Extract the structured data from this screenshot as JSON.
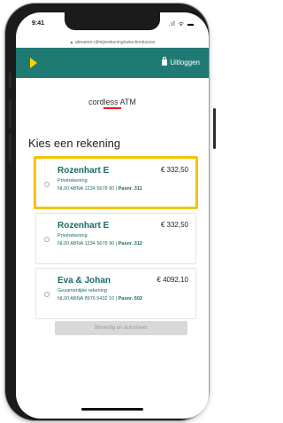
{
  "status": {
    "time": "9:41",
    "icons": ".ıl ᯤ ▬"
  },
  "browser": {
    "url": "▲ abnamro.nl/mijnrekening/selectiontuvzoo"
  },
  "header": {
    "logout_label": "Uitloggen",
    "accent": "#1f7a73",
    "logo_color": "#ffd200"
  },
  "brand": {
    "name": "cordless ATM"
  },
  "main": {
    "title": "Kies een rekening",
    "accounts": [
      {
        "name": "Rozenhart E",
        "type": "Privérekening",
        "iban": "NL00 ABNA 1234 5678 90 | ",
        "pas": "Pasnr. 311",
        "balance": "€ 332,50",
        "selected": true
      },
      {
        "name": "Rozenhart E",
        "type": "Privérekening",
        "iban": "NL00 ABNA 1234 5678 90 | ",
        "pas": "Pasnr. 312",
        "balance": "€ 332,50",
        "selected": false
      },
      {
        "name": "Eva & Johan",
        "type": "Gezamenlijke rekening",
        "iban": "NL00 ABNA 8976 5432 10 | ",
        "pas": "Pasnr. 502",
        "balance": "€ 4092,10",
        "selected": false
      }
    ],
    "confirm_label": "Bevestig en autoriseer",
    "highlight_color": "#f5c400"
  }
}
